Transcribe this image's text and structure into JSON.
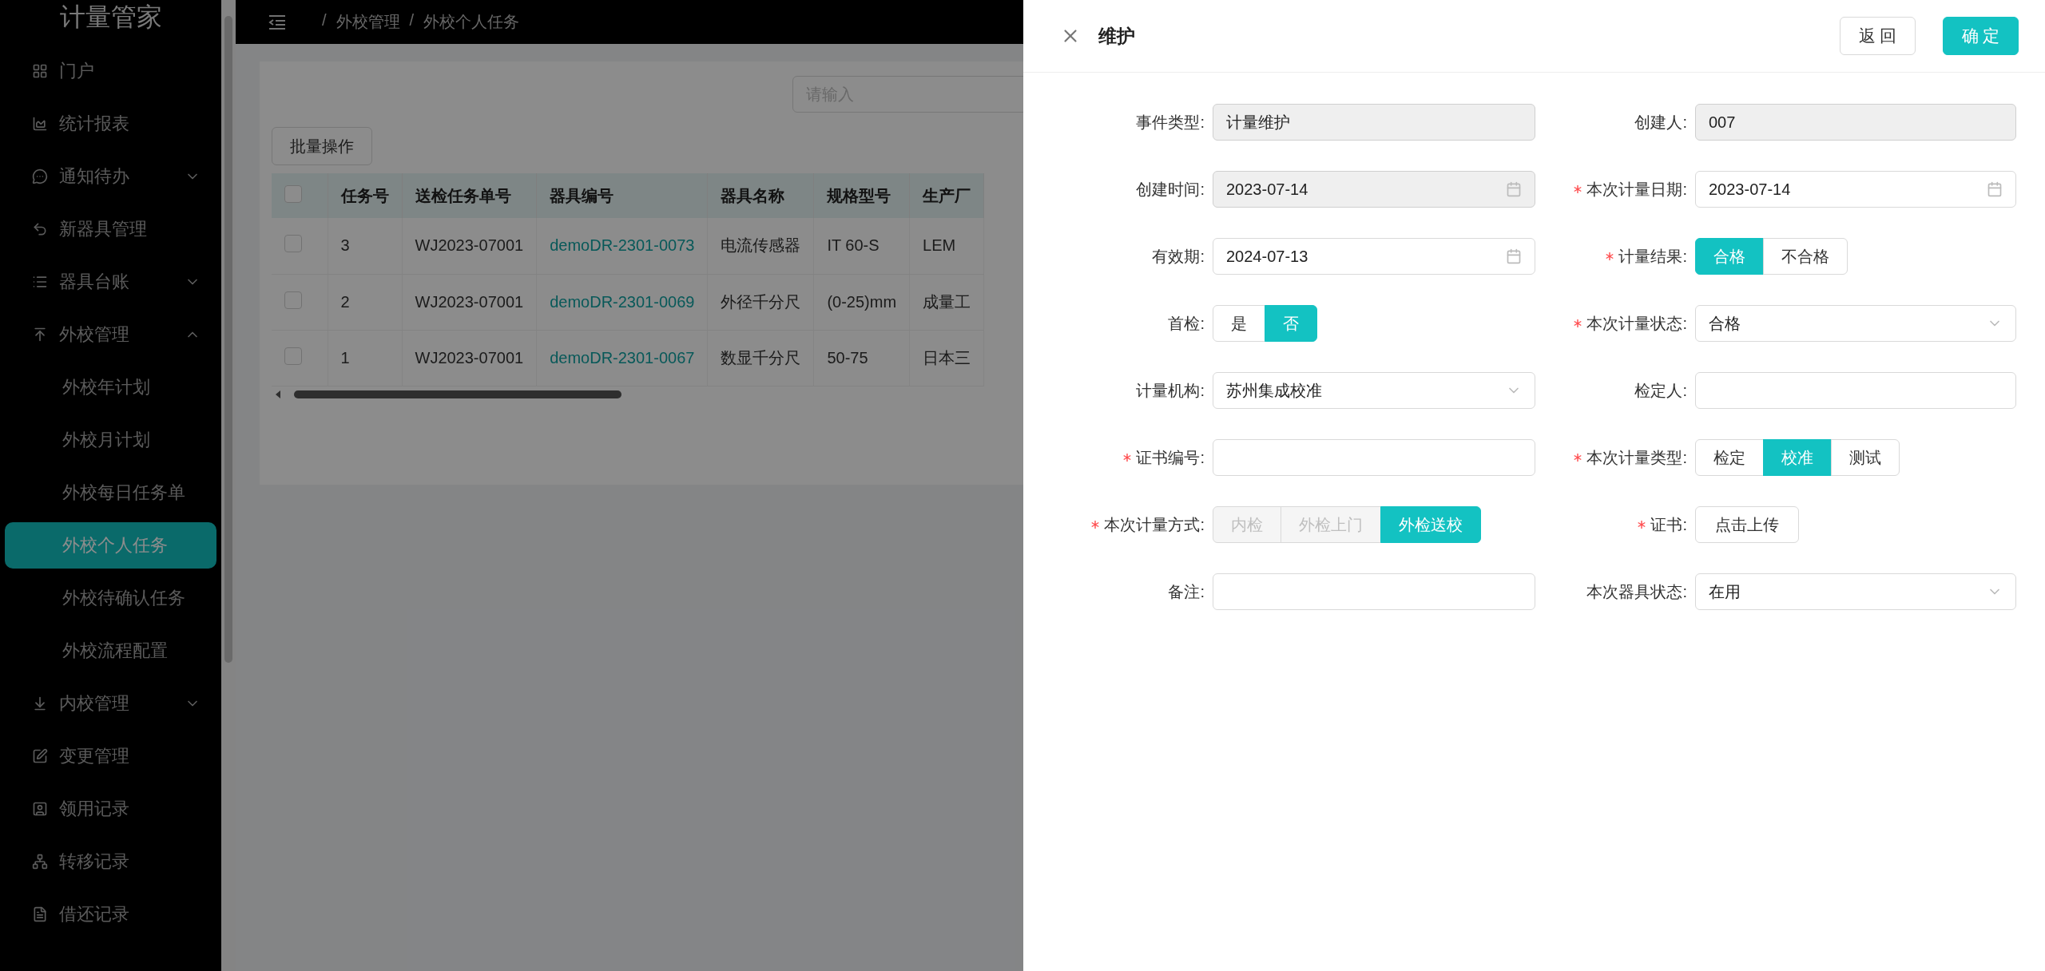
{
  "app": {
    "title": "计量管家"
  },
  "sidebar": {
    "items": [
      {
        "label": "门户",
        "kind": "link",
        "selected": false
      },
      {
        "label": "统计报表",
        "kind": "link",
        "selected": false
      },
      {
        "label": "通知待办",
        "kind": "group",
        "expanded": false,
        "selected": false
      },
      {
        "label": "新器具管理",
        "kind": "link",
        "selected": false
      },
      {
        "label": "器具台账",
        "kind": "group",
        "expanded": false,
        "selected": false
      },
      {
        "label": "外校管理",
        "kind": "group",
        "expanded": true,
        "selected": false,
        "children": [
          {
            "label": "外校年计划",
            "selected": false
          },
          {
            "label": "外校月计划",
            "selected": false
          },
          {
            "label": "外校每日任务单",
            "selected": false
          },
          {
            "label": "外校个人任务",
            "selected": true
          },
          {
            "label": "外校待确认任务",
            "selected": false
          },
          {
            "label": "外校流程配置",
            "selected": false
          }
        ]
      },
      {
        "label": "内校管理",
        "kind": "group",
        "expanded": false,
        "selected": false
      },
      {
        "label": "变更管理",
        "kind": "link",
        "selected": false
      },
      {
        "label": "领用记录",
        "kind": "link",
        "selected": false
      },
      {
        "label": "转移记录",
        "kind": "link",
        "selected": false
      },
      {
        "label": "借还记录",
        "kind": "link",
        "selected": false
      }
    ]
  },
  "header": {
    "separator": "/",
    "breadcrumb": [
      "外校管理",
      "外校个人任务"
    ]
  },
  "toolbar": {
    "search": {
      "placeholder": "请输入"
    },
    "batch_button": "批量操作"
  },
  "table": {
    "header_checked": false,
    "columns": [
      {
        "label": "任务号",
        "kind": "text"
      },
      {
        "label": "送检任务单号",
        "kind": "text"
      },
      {
        "label": "器具编号",
        "kind": "link"
      },
      {
        "label": "器具名称",
        "kind": "text"
      },
      {
        "label": "规格型号",
        "kind": "text"
      },
      {
        "label": "生产厂",
        "kind": "text"
      }
    ],
    "rows": [
      {
        "checked": false,
        "cells": [
          "3",
          "WJ2023-07001",
          "demoDR-2301-0073",
          "电流传感器",
          "IT 60-S",
          "LEM"
        ]
      },
      {
        "checked": false,
        "cells": [
          "2",
          "WJ2023-07001",
          "demoDR-2301-0069",
          "外径千分尺",
          "(0-25)mm",
          "成量工"
        ]
      },
      {
        "checked": false,
        "cells": [
          "1",
          "WJ2023-07001",
          "demoDR-2301-0067",
          "数显千分尺",
          "50-75",
          "日本三"
        ]
      }
    ]
  },
  "drawer": {
    "title": "维护",
    "buttons": [
      {
        "label": "返 回",
        "kind": "default"
      },
      {
        "label": "确 定",
        "kind": "primary"
      }
    ],
    "fields": [
      {
        "label": "事件类型:",
        "required": false,
        "kind": "text",
        "value": "计量维护",
        "disabled": true
      },
      {
        "label": "创建人:",
        "required": false,
        "kind": "text",
        "value": "007",
        "disabled": true
      },
      {
        "label": "创建时间:",
        "required": false,
        "kind": "date",
        "value": "2023-07-14",
        "disabled": true
      },
      {
        "label": "本次计量日期:",
        "required": true,
        "kind": "date",
        "value": "2023-07-14",
        "disabled": false
      },
      {
        "label": "有效期:",
        "required": false,
        "kind": "date",
        "value": "2024-07-13",
        "disabled": false
      },
      {
        "label": "计量结果:",
        "required": true,
        "kind": "segmented",
        "options": [
          {
            "label": "合格",
            "selected": true,
            "disabled": false
          },
          {
            "label": "不合格",
            "selected": false,
            "disabled": false
          }
        ]
      },
      {
        "label": "首检:",
        "required": false,
        "kind": "segmented",
        "options": [
          {
            "label": "是",
            "selected": false,
            "disabled": false
          },
          {
            "label": "否",
            "selected": true,
            "disabled": false
          }
        ]
      },
      {
        "label": "本次计量状态:",
        "required": true,
        "kind": "select",
        "value": "合格"
      },
      {
        "label": "计量机构:",
        "required": false,
        "kind": "select",
        "value": "苏州集成校准"
      },
      {
        "label": "检定人:",
        "required": false,
        "kind": "text",
        "disabled": false
      },
      {
        "label": "证书编号:",
        "required": true,
        "kind": "text",
        "disabled": false
      },
      {
        "label": "本次计量类型:",
        "required": true,
        "kind": "segmented",
        "options": [
          {
            "label": "检定",
            "selected": false,
            "disabled": false
          },
          {
            "label": "校准",
            "selected": true,
            "disabled": false
          },
          {
            "label": "测试",
            "selected": false,
            "disabled": false
          }
        ]
      },
      {
        "label": "本次计量方式:",
        "required": true,
        "kind": "segmented",
        "options": [
          {
            "label": "内检",
            "selected": false,
            "disabled": true
          },
          {
            "label": "外检上门",
            "selected": false,
            "disabled": true
          },
          {
            "label": "外检送校",
            "selected": true,
            "disabled": false
          }
        ]
      },
      {
        "label": "证书:",
        "required": true,
        "kind": "upload",
        "button": "点击上传"
      },
      {
        "label": "备注:",
        "required": false,
        "kind": "text",
        "disabled": false
      },
      {
        "label": "本次器具状态:",
        "required": false,
        "kind": "select",
        "value": "在用"
      }
    ]
  }
}
